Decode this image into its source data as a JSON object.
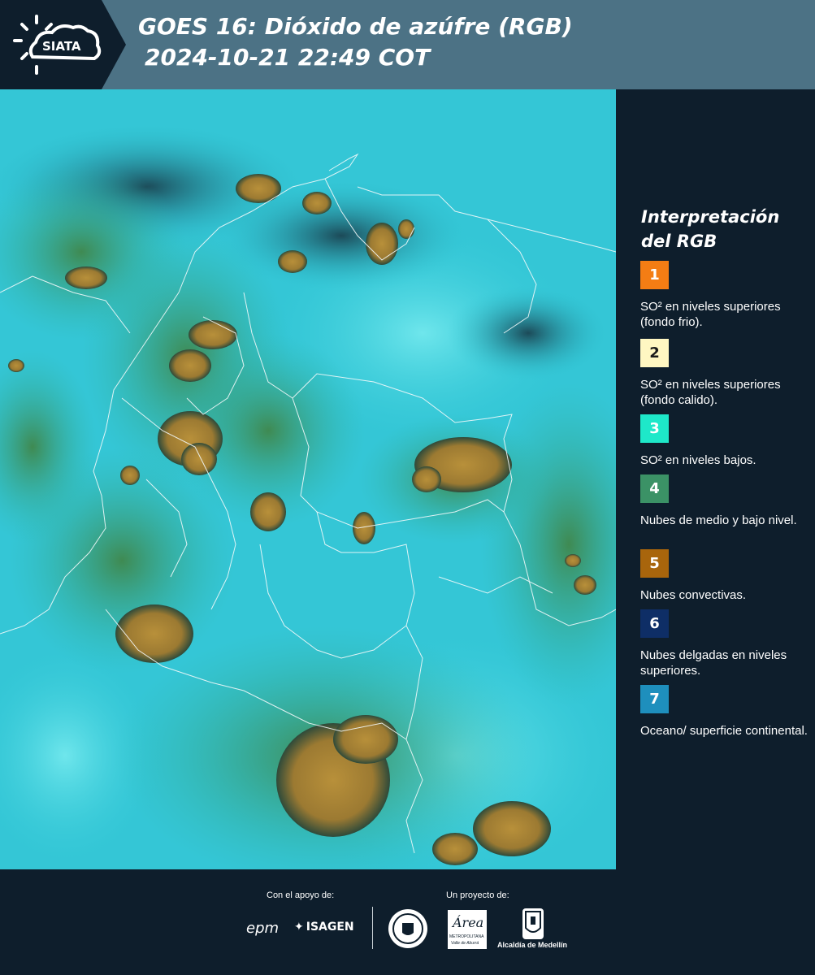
{
  "header": {
    "logo_text": "SIATA",
    "title_line1": "GOES 16: Dióxido de azúfre (RGB)",
    "title_line2": "2024-10-21 22:49 COT"
  },
  "map": {
    "description_icon": "satellite-rgb-image"
  },
  "legend": {
    "title": "Interpretación del RGB",
    "items": [
      {
        "number": "1",
        "color": "#f47d14",
        "label": "SO² en niveles superiores (fondo frio)."
      },
      {
        "number": "2",
        "color": "#fff7c2",
        "label": "SO² en niveles superiores (fondo calido)."
      },
      {
        "number": "3",
        "color": "#1ee8c9",
        "label": "SO² en niveles bajos."
      },
      {
        "number": "4",
        "color": "#3b9266",
        "label": "Nubes de medio y bajo nivel."
      },
      {
        "number": "5",
        "color": "#a8650c",
        "label": "Nubes convectivas."
      },
      {
        "number": "6",
        "color": "#0e2e66",
        "label": "Nubes delgadas en niveles superiores."
      },
      {
        "number": "7",
        "color": "#1e8fbd",
        "label": "Oceano/ superficie continental."
      }
    ]
  },
  "footer": {
    "support_label": "Con el apoyo de:",
    "project_label": "Un proyecto de:",
    "sponsor_epm": "epm",
    "sponsor_isagen": "ISAGEN",
    "area_metropolitana": "Área",
    "area_metropolitana_sub": "METROPOLITANA",
    "area_metropolitana_sub2": "Valle de Aburrá",
    "alcaldia": "Alcaldía de Medellín"
  }
}
